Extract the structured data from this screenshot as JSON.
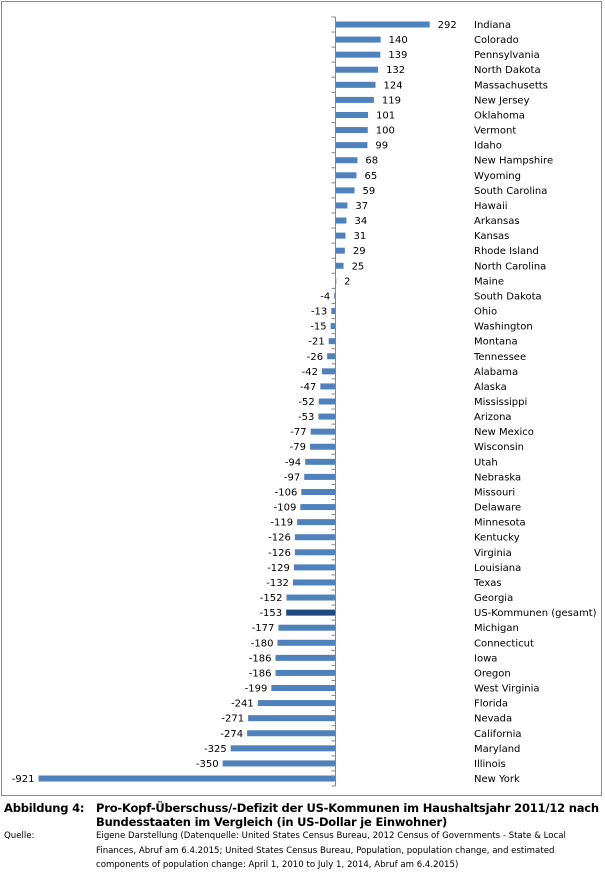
{
  "chart_data": {
    "type": "bar",
    "orientation": "horizontal",
    "title": "Pro-Kopf-Überschuss/-Defizit der US-Kommunen im Haushaltsjahr 2011/12 nach Bundesstaaten im Vergleich (in US-Dollar je Einwohner)",
    "xlabel": "",
    "ylabel": "",
    "xlim": [
      -921,
      292
    ],
    "grid": false,
    "legend": "none",
    "categories": [
      "Indiana",
      "Colorado",
      "Pennsylvania",
      "North Dakota",
      "Massachusetts",
      "New Jersey",
      "Oklahoma",
      "Vermont",
      "Idaho",
      "New Hampshire",
      "Wyoming",
      "South Carolina",
      "Hawaii",
      "Arkansas",
      "Kansas",
      "Rhode Island",
      "North Carolina",
      "Maine",
      "South Dakota",
      "Ohio",
      "Washington",
      "Montana",
      "Tennessee",
      "Alabama",
      "Alaska",
      "Mississippi",
      "Arizona",
      "New Mexico",
      "Wisconsin",
      "Utah",
      "Nebraska",
      "Missouri",
      "Delaware",
      "Minnesota",
      "Kentucky",
      "Virginia",
      "Louisiana",
      "Texas",
      "Georgia",
      "US-Kommunen (gesamt)",
      "Michigan",
      "Connecticut",
      "Iowa",
      "Oregon",
      "West Virginia",
      "Florida",
      "Nevada",
      "California",
      "Maryland",
      "Illinois",
      "New York"
    ],
    "values": [
      292,
      140,
      139,
      132,
      124,
      119,
      101,
      100,
      99,
      68,
      65,
      59,
      37,
      34,
      31,
      29,
      25,
      2,
      -4,
      -13,
      -15,
      -21,
      -26,
      -42,
      -47,
      -52,
      -53,
      -77,
      -79,
      -94,
      -97,
      -106,
      -109,
      -119,
      -126,
      -126,
      -129,
      -132,
      -152,
      -153,
      -177,
      -180,
      -186,
      -186,
      -199,
      -241,
      -271,
      -274,
      -325,
      -350,
      -921
    ],
    "highlight_category": "US-Kommunen (gesamt)",
    "colors": {
      "bar": "#4f81bd",
      "highlight": "#1f497d",
      "axis": "#868686"
    }
  },
  "caption": {
    "figure_label": "Abbildung 4:",
    "figure_title": "Pro-Kopf-Überschuss/-Defizit der US-Kommunen im Haushaltsjahr 2011/12 nach Bundesstaaten im Vergleich (in US-Dollar je Einwohner)",
    "source_label": "Quelle:",
    "source_text": "Eigene Darstellung (Datenquelle: United States Census Bureau, 2012 Census of Governments - State & Local Finances, Abruf am 6.4.2015; United States Census Bureau, Population, population change, and estimated components of population change: April 1, 2010 to July 1, 2014, Abruf am 6.4.2015)"
  }
}
